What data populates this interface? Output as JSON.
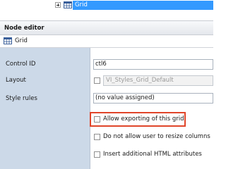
{
  "tree": {
    "selected_node": "Grid",
    "icon": "grid-icon"
  },
  "node_editor": {
    "title": "Node editor",
    "node_type_label": "Grid",
    "node_icon": "grid-icon"
  },
  "properties": {
    "control_id": {
      "label": "Control ID",
      "value": "ctl6"
    },
    "layout": {
      "label": "Layout",
      "value": "VI_Styles_Grid_Default",
      "checked": false
    },
    "style_rules": {
      "label": "Style rules",
      "value": "(no value assigned)"
    }
  },
  "options": [
    {
      "label": "Allow exporting of this grid",
      "checked": false,
      "highlighted": true
    },
    {
      "label": "Do not allow user to resize columns",
      "checked": false
    },
    {
      "label": "Insert additional HTML attributes",
      "checked": false
    }
  ],
  "colors": {
    "selection": "#3399ff",
    "label_column": "#ccd9e8",
    "highlight_border": "#e0452a"
  }
}
